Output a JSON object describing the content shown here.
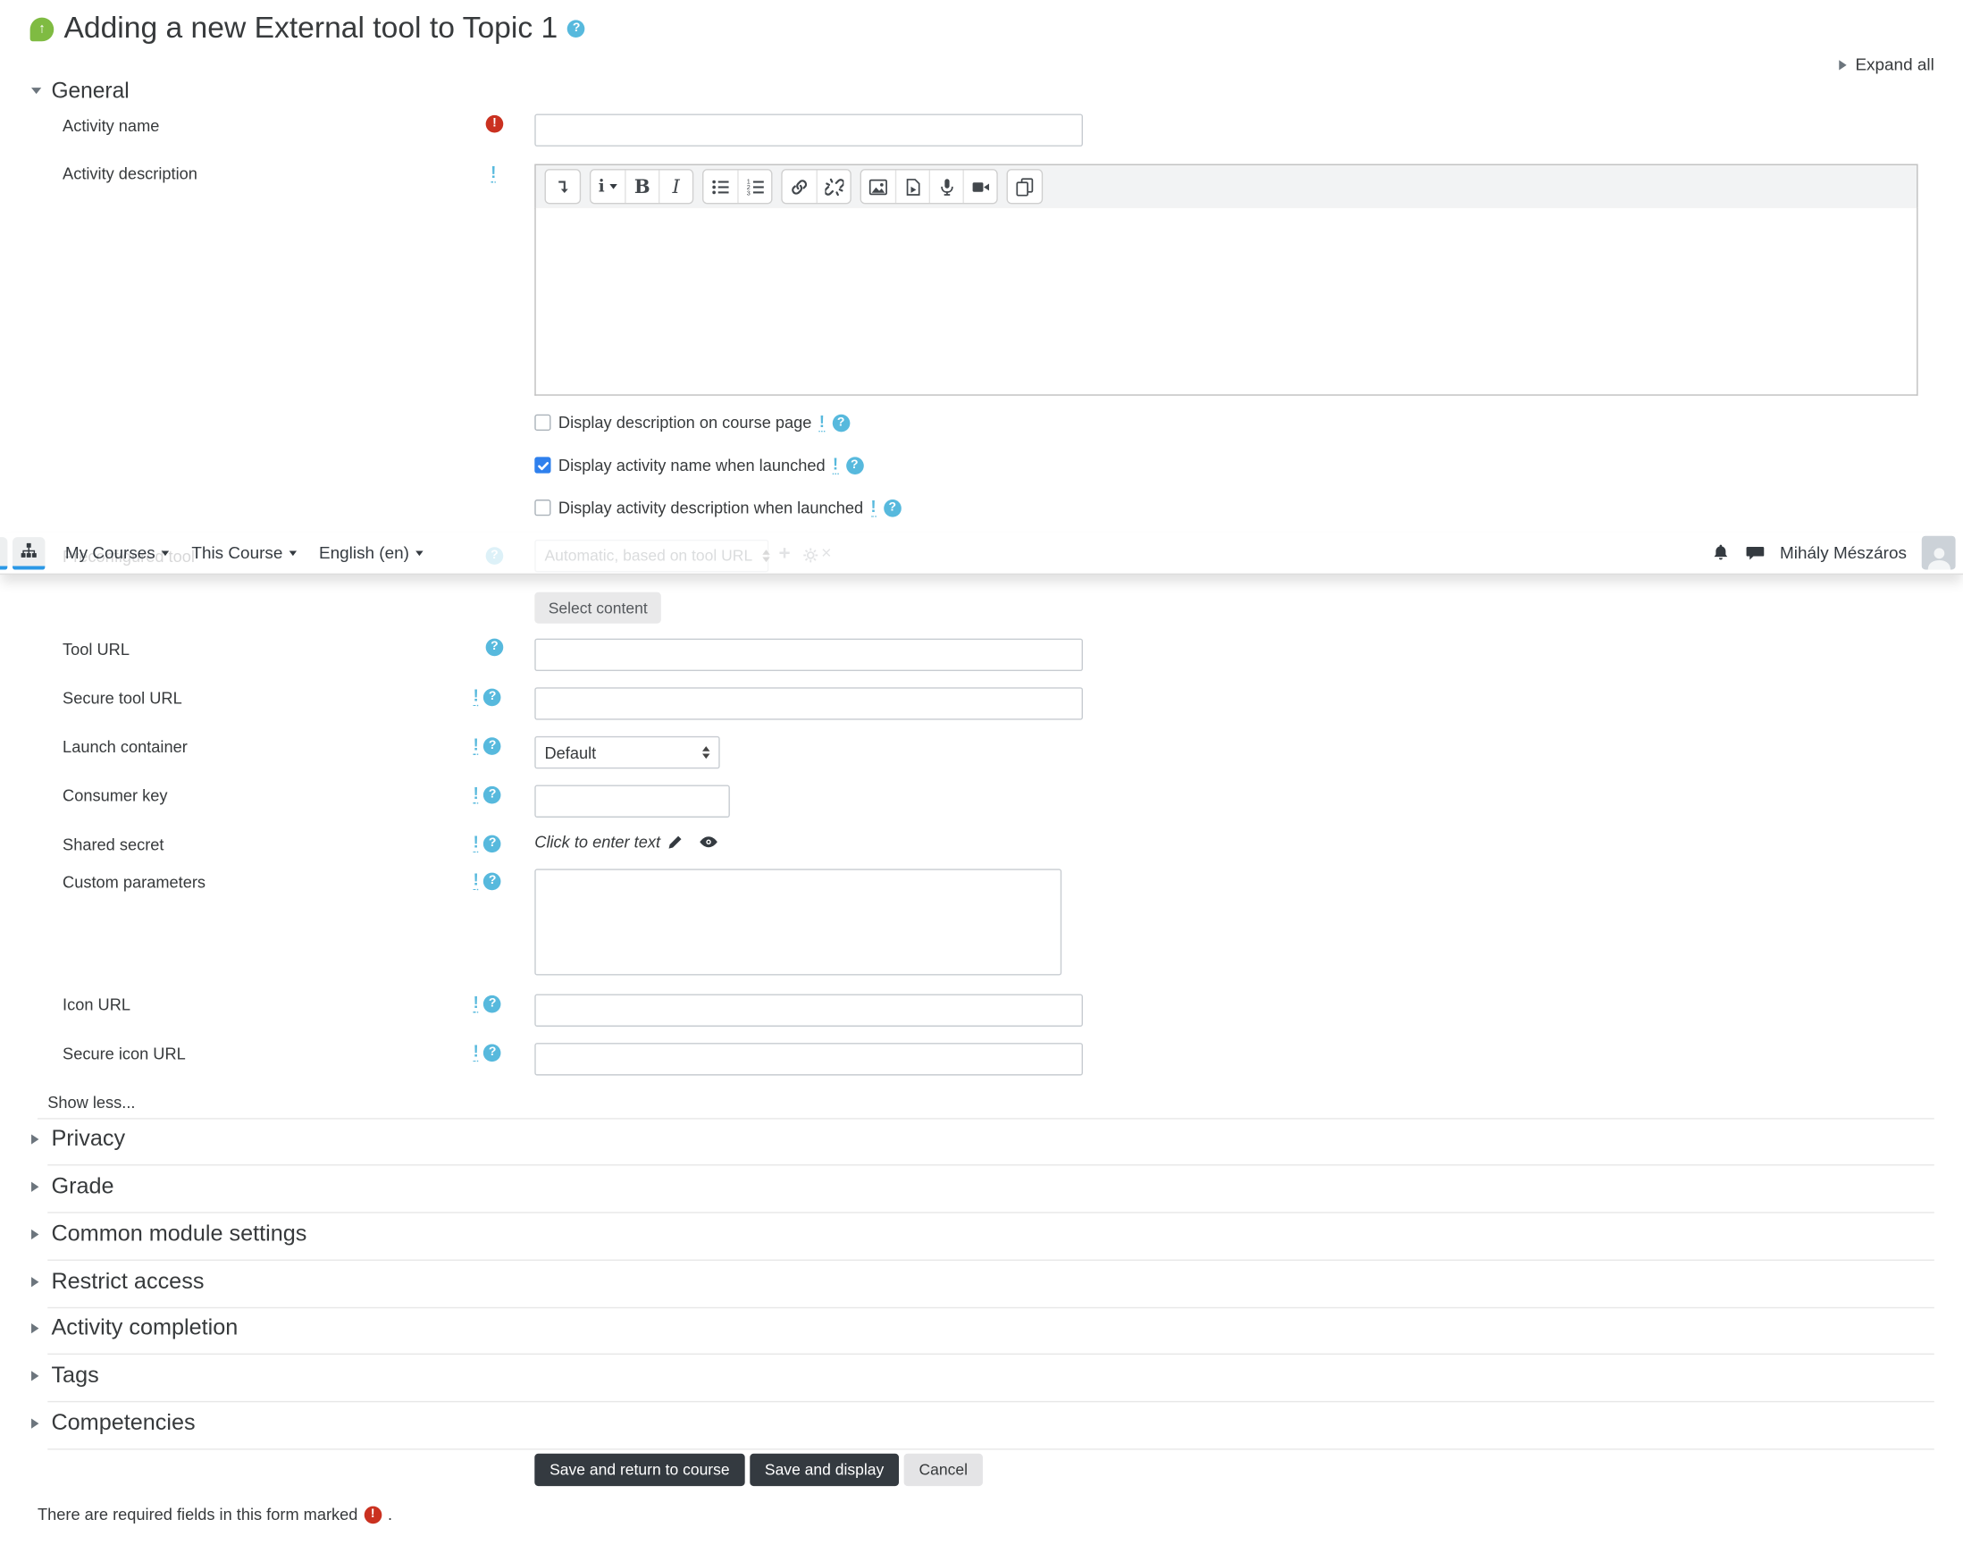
{
  "header": {
    "title": "Adding a new External tool to Topic 1",
    "expand_all": "Expand all"
  },
  "navbar": {
    "menu": [
      "My Courses",
      "This Course",
      "English (en)"
    ],
    "user_name": "Mihály Mészáros",
    "icons": [
      "sitemap-icon",
      "bell-icon",
      "chat-icon",
      "avatar"
    ]
  },
  "general": {
    "heading": "General",
    "activity_name_label": "Activity name",
    "activity_name_value": "",
    "activity_description_label": "Activity description",
    "editor_content": "",
    "editor_toolbar_icons": [
      "collapse-toolbar-icon",
      "format-style-icon",
      "bold-icon",
      "italic-icon",
      "unordered-list-icon",
      "ordered-list-icon",
      "link-icon",
      "unlink-icon",
      "image-icon",
      "media-icon",
      "record-audio-icon",
      "record-video-icon",
      "manage-files-icon"
    ],
    "checkboxes": [
      {
        "label": "Display description on course page",
        "checked": false
      },
      {
        "label": "Display activity name when launched",
        "checked": true
      },
      {
        "label": "Display activity description when launched",
        "checked": false
      }
    ],
    "preconfigured_tool_label": "Preconfigured tool",
    "preconfigured_tool_value": "Automatic, based on tool URL",
    "select_content": "Select content",
    "tool_url_label": "Tool URL",
    "tool_url_value": "",
    "secure_tool_url_label": "Secure tool URL",
    "secure_tool_url_value": "",
    "launch_container_label": "Launch container",
    "launch_container_value": "Default",
    "consumer_key_label": "Consumer key",
    "consumer_key_value": "",
    "shared_secret_label": "Shared secret",
    "shared_secret_placeholder": "Click to enter text",
    "custom_parameters_label": "Custom parameters",
    "custom_parameters_value": "",
    "icon_url_label": "Icon URL",
    "icon_url_value": "",
    "secure_icon_url_label": "Secure icon URL",
    "secure_icon_url_value": "",
    "show_less": "Show less..."
  },
  "collapsed_sections": [
    {
      "heading": "Privacy"
    },
    {
      "heading": "Grade"
    },
    {
      "heading": "Common module settings"
    },
    {
      "heading": "Restrict access"
    },
    {
      "heading": "Activity completion"
    },
    {
      "heading": "Tags"
    },
    {
      "heading": "Competencies"
    }
  ],
  "actions": {
    "save_return": "Save and return to course",
    "save_display": "Save and display",
    "cancel": "Cancel"
  },
  "footer": {
    "required_note": "There are required fields in this form marked",
    "period": "."
  },
  "colors": {
    "checkbox_blue": "#2f80ed",
    "nav_underline_blue": "#2b98e6",
    "help_blue": "#57b9dd",
    "required_red": "#ca3120",
    "button_dark": "#343a40",
    "external_tool_green": "#7fbb42"
  }
}
